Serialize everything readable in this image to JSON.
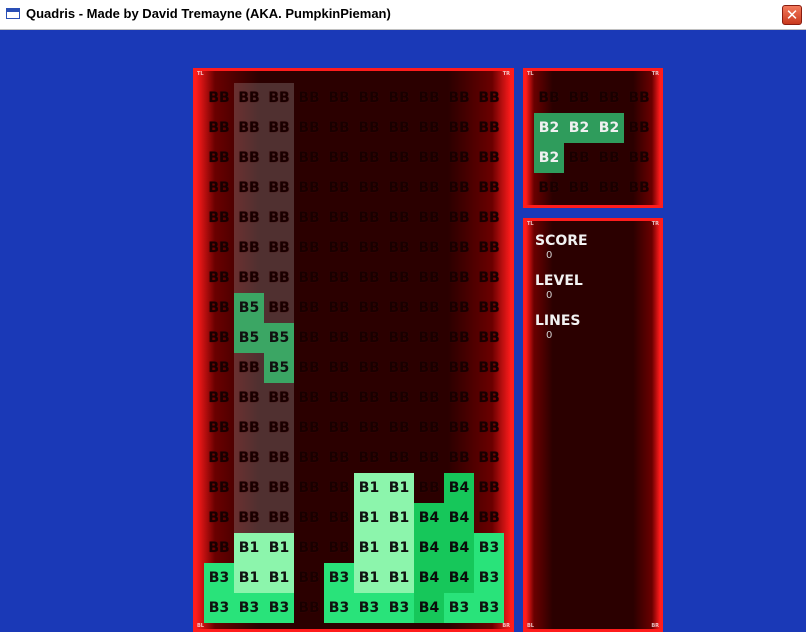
{
  "window": {
    "title": "Quadris - Made by David Tremayne (AKA. PumpkinPieman)"
  },
  "icons": {
    "app": "window-icon",
    "close": "close-icon"
  },
  "colors": {
    "background": "#1a39b7",
    "panel_border": "#ff1c1c",
    "board_fill": "#2b0000"
  },
  "corner_labels": {
    "top_left": "TL",
    "top_right": "TR",
    "bottom_left": "BL",
    "bottom_right": "BR"
  },
  "board": {
    "columns": 10,
    "rows": 18,
    "ghost_columns": [
      1,
      2
    ],
    "cells": [
      [
        "BB",
        "BB",
        "BB",
        "BB",
        "BB",
        "BB",
        "BB",
        "BB",
        "BB",
        "BB"
      ],
      [
        "BB",
        "BB",
        "BB",
        "BB",
        "BB",
        "BB",
        "BB",
        "BB",
        "BB",
        "BB"
      ],
      [
        "BB",
        "BB",
        "BB",
        "BB",
        "BB",
        "BB",
        "BB",
        "BB",
        "BB",
        "BB"
      ],
      [
        "BB",
        "BB",
        "BB",
        "BB",
        "BB",
        "BB",
        "BB",
        "BB",
        "BB",
        "BB"
      ],
      [
        "BB",
        "BB",
        "BB",
        "BB",
        "BB",
        "BB",
        "BB",
        "BB",
        "BB",
        "BB"
      ],
      [
        "BB",
        "BB",
        "BB",
        "BB",
        "BB",
        "BB",
        "BB",
        "BB",
        "BB",
        "BB"
      ],
      [
        "BB",
        "BB",
        "BB",
        "BB",
        "BB",
        "BB",
        "BB",
        "BB",
        "BB",
        "BB"
      ],
      [
        "BB",
        "B5",
        "BB",
        "BB",
        "BB",
        "BB",
        "BB",
        "BB",
        "BB",
        "BB"
      ],
      [
        "BB",
        "B5",
        "B5",
        "BB",
        "BB",
        "BB",
        "BB",
        "BB",
        "BB",
        "BB"
      ],
      [
        "BB",
        "BB",
        "B5",
        "BB",
        "BB",
        "BB",
        "BB",
        "BB",
        "BB",
        "BB"
      ],
      [
        "BB",
        "BB",
        "BB",
        "BB",
        "BB",
        "BB",
        "BB",
        "BB",
        "BB",
        "BB"
      ],
      [
        "BB",
        "BB",
        "BB",
        "BB",
        "BB",
        "BB",
        "BB",
        "BB",
        "BB",
        "BB"
      ],
      [
        "BB",
        "BB",
        "BB",
        "BB",
        "BB",
        "BB",
        "BB",
        "BB",
        "BB",
        "BB"
      ],
      [
        "BB",
        "BB",
        "BB",
        "BB",
        "BB",
        "B1",
        "B1",
        "BB",
        "B4",
        "BB"
      ],
      [
        "BB",
        "BB",
        "BB",
        "BB",
        "BB",
        "B1",
        "B1",
        "B4",
        "B4",
        "BB"
      ],
      [
        "BB",
        "B1",
        "B1",
        "BB",
        "BB",
        "B1",
        "B1",
        "B4",
        "B4",
        "B3"
      ],
      [
        "B3",
        "B1",
        "B1",
        "BB",
        "B3",
        "B1",
        "B1",
        "B4",
        "B4",
        "B3"
      ],
      [
        "B3",
        "B3",
        "B3",
        "BB",
        "B3",
        "B3",
        "B3",
        "B4",
        "B3",
        "B3"
      ]
    ]
  },
  "next_piece": {
    "cells": [
      [
        "BB",
        "BB",
        "BB",
        "BB"
      ],
      [
        "B2",
        "B2",
        "B2",
        "BB"
      ],
      [
        "B2",
        "BB",
        "BB",
        "BB"
      ],
      [
        "BB",
        "BB",
        "BB",
        "BB"
      ]
    ]
  },
  "stats": {
    "score_label": "SCORE",
    "score_value": "0",
    "level_label": "LEVEL",
    "level_value": "0",
    "lines_label": "LINES",
    "lines_value": "0"
  }
}
